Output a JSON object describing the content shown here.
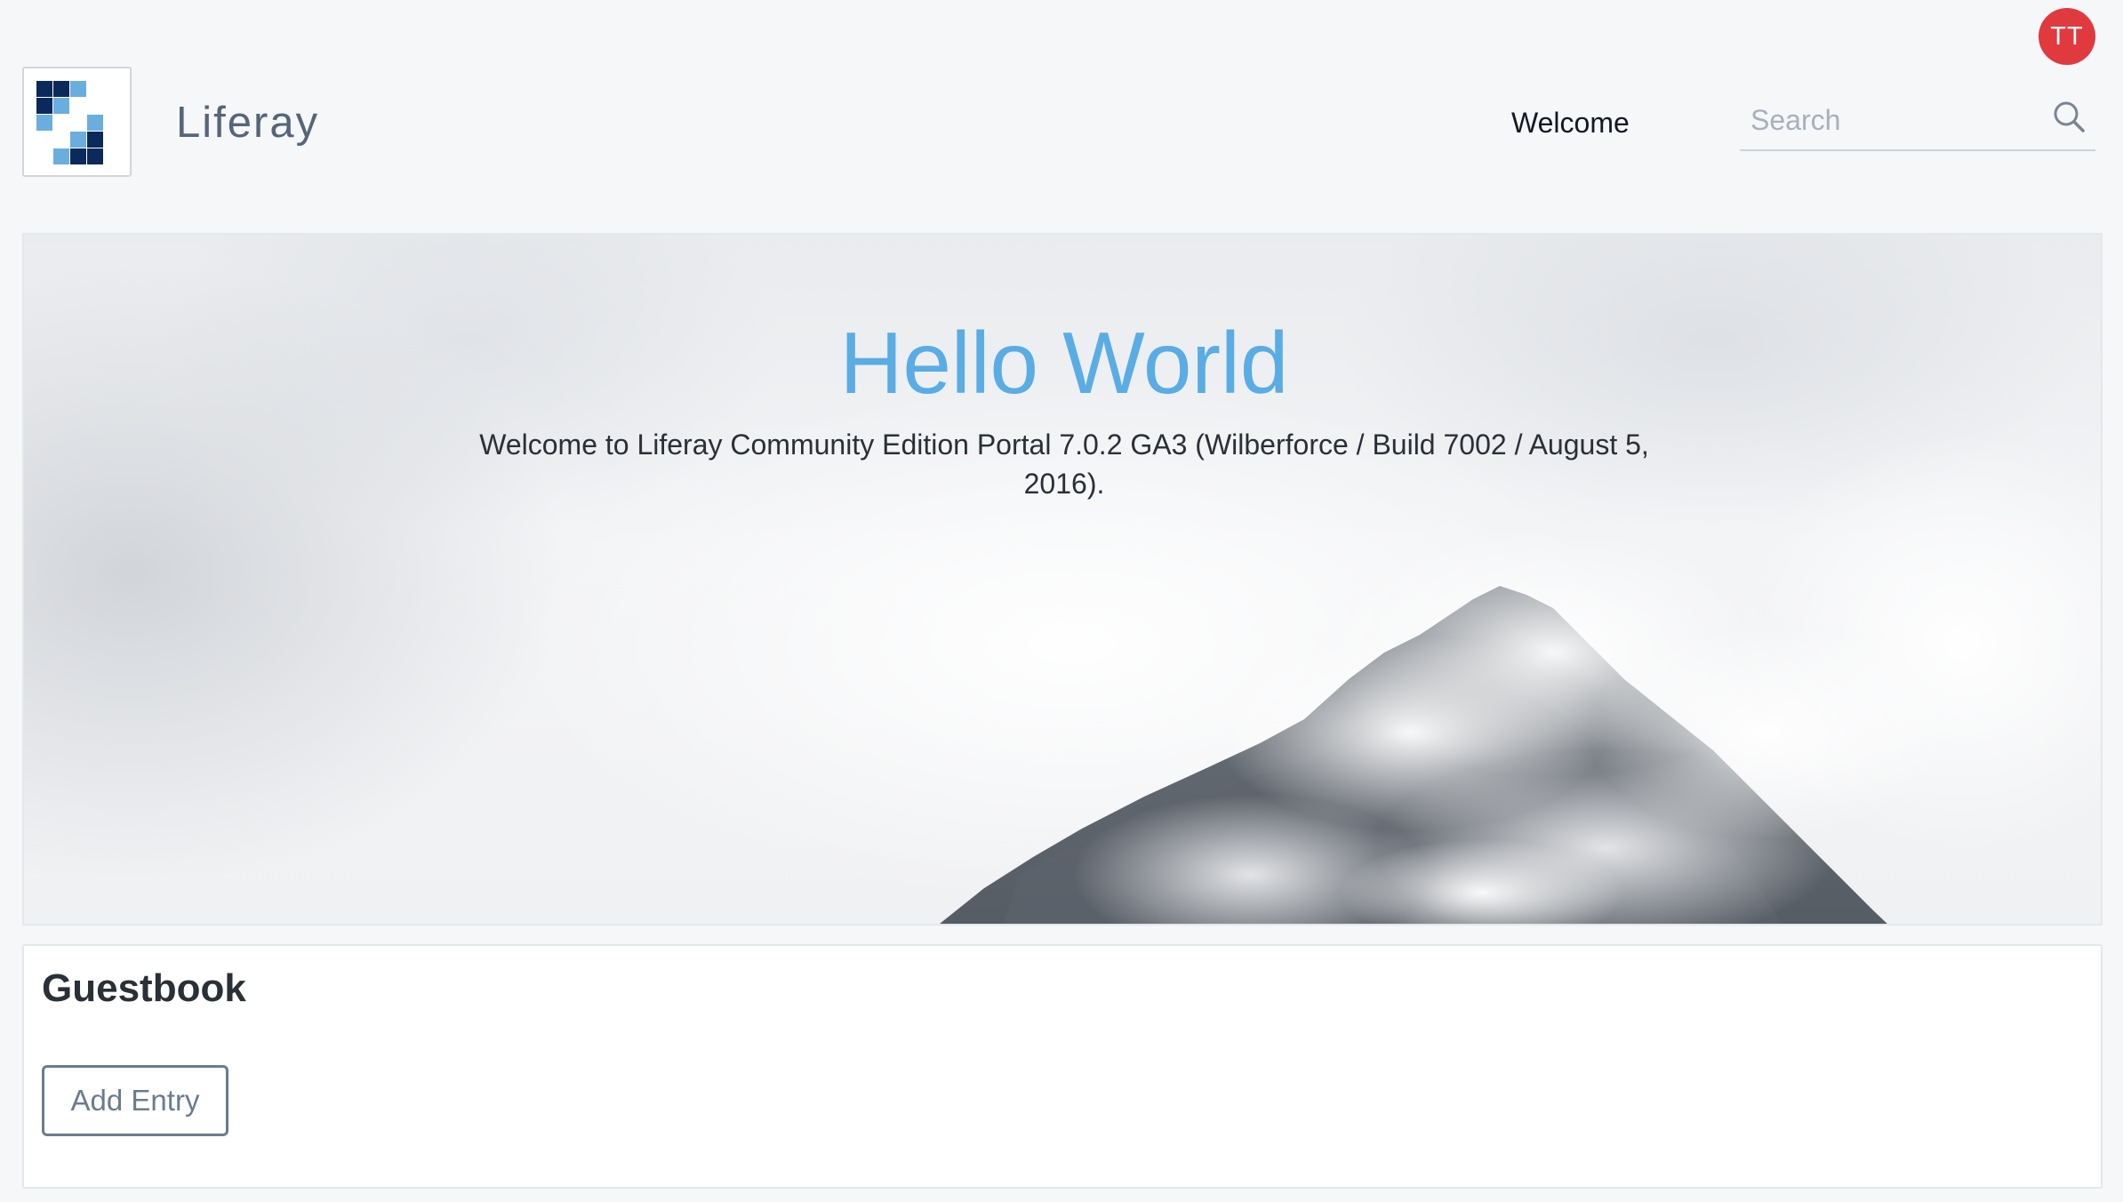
{
  "header": {
    "user_initials": "TT",
    "site_name": "Liferay",
    "nav": [
      {
        "label": "Welcome"
      }
    ],
    "search": {
      "placeholder": "Search",
      "value": "",
      "icon": "search-icon"
    }
  },
  "hero": {
    "title": "Hello World",
    "subtitle": "Welcome to Liferay Community Edition Portal 7.0.2 GA3 (Wilberforce / Build 7002 / August 5, 2016)."
  },
  "guestbook": {
    "title": "Guestbook",
    "add_entry_label": "Add Entry"
  },
  "colors": {
    "avatar": "#e0393e",
    "hero_title": "#5aace4",
    "page_background": "#f5f7f9"
  }
}
